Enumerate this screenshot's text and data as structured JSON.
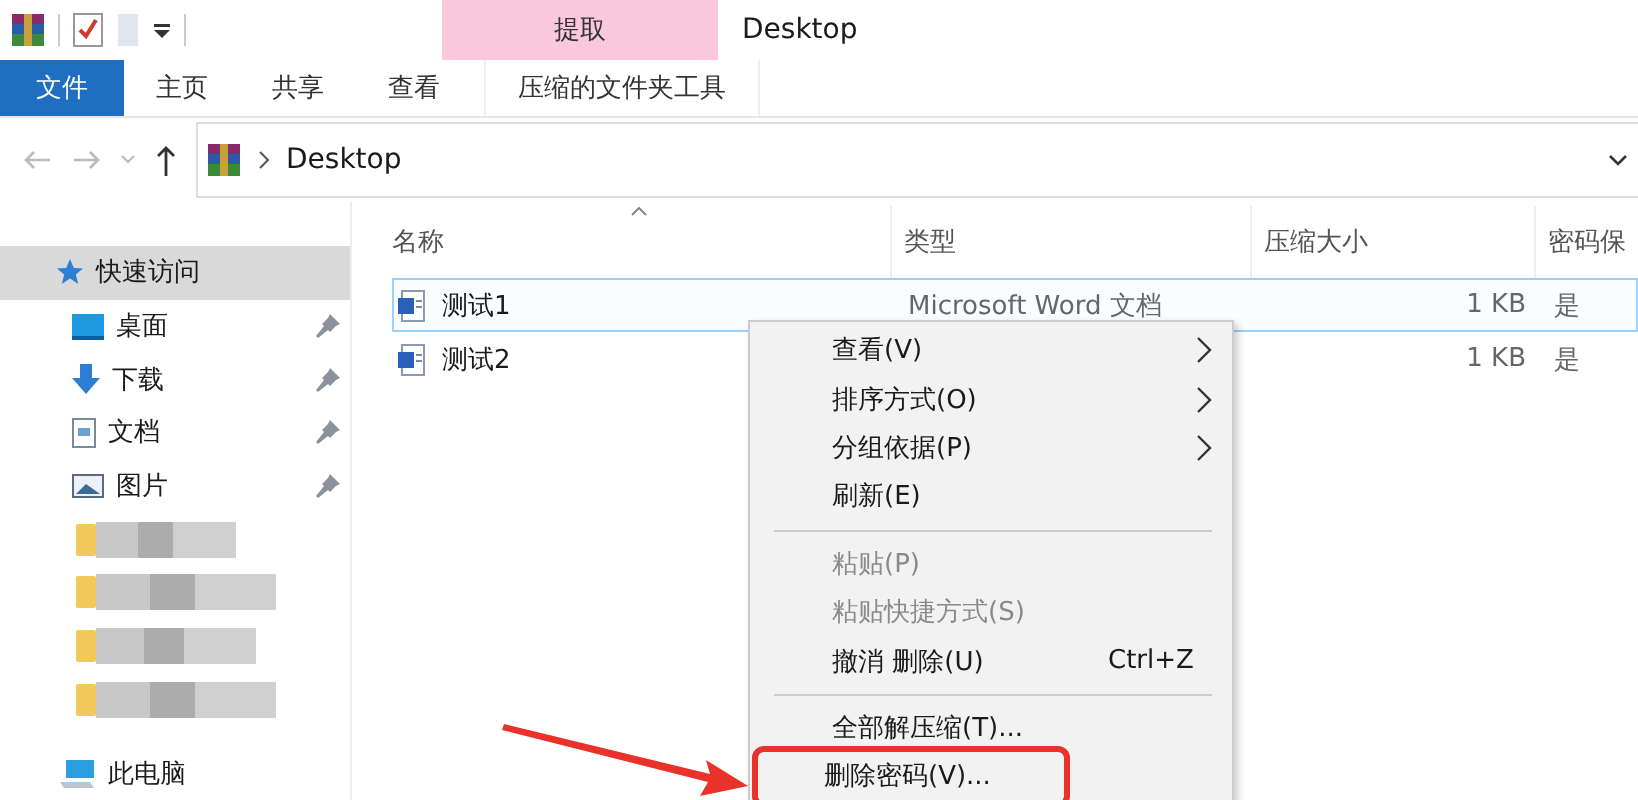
{
  "window": {
    "title": "Desktop"
  },
  "contextual_tab": {
    "label": "提取"
  },
  "ribbon_tabs": [
    {
      "label": "文件",
      "selected": true,
      "kind": "file"
    },
    {
      "label": "主页",
      "selected": false,
      "kind": "tab"
    },
    {
      "label": "共享",
      "selected": false,
      "kind": "tab"
    },
    {
      "label": "查看",
      "selected": false,
      "kind": "tab"
    },
    {
      "label": "压缩的文件夹工具",
      "selected": false,
      "kind": "contextual"
    }
  ],
  "address": {
    "path": "Desktop"
  },
  "sidebar": {
    "items": [
      {
        "label": "快速访问",
        "kind": "quick",
        "selected": true
      },
      {
        "label": "桌面",
        "kind": "desktop",
        "selected": false,
        "pinned": true
      },
      {
        "label": "下载",
        "kind": "download",
        "selected": false,
        "pinned": true
      },
      {
        "label": "文档",
        "kind": "documents",
        "selected": false,
        "pinned": true
      },
      {
        "label": "图片",
        "kind": "pictures",
        "selected": false,
        "pinned": true
      },
      {
        "kind": "redacted-folder",
        "selected": false
      },
      {
        "kind": "redacted-folder",
        "selected": false
      },
      {
        "kind": "redacted-folder",
        "selected": false
      },
      {
        "kind": "redacted-folder",
        "selected": false
      },
      {
        "label": "此电脑",
        "kind": "pc",
        "selected": false
      }
    ]
  },
  "table": {
    "columns": [
      "名称",
      "类型",
      "压缩大小",
      "密码保"
    ],
    "rows": [
      {
        "name": "测试1",
        "type": "Microsoft Word 文档",
        "size": "1 KB",
        "protected": "是",
        "selected": true
      },
      {
        "name": "测试2",
        "size": "1 KB",
        "protected": "是",
        "selected": false
      }
    ]
  },
  "context_menu": {
    "items": [
      {
        "kind": "item",
        "label": "查看(V)",
        "submenu": true,
        "disabled": false,
        "highlighted": false
      },
      {
        "kind": "item",
        "label": "排序方式(O)",
        "submenu": true,
        "disabled": false,
        "highlighted": false
      },
      {
        "kind": "item",
        "label": "分组依据(P)",
        "submenu": true,
        "disabled": false,
        "highlighted": false
      },
      {
        "kind": "item",
        "label": "刷新(E)",
        "disabled": false,
        "highlighted": false
      },
      {
        "kind": "separator"
      },
      {
        "kind": "item",
        "label": "粘贴(P)",
        "disabled": true,
        "highlighted": false
      },
      {
        "kind": "item",
        "label": "粘贴快捷方式(S)",
        "disabled": true,
        "highlighted": false
      },
      {
        "kind": "item",
        "label": "撤消 删除(U)",
        "shortcut": "Ctrl+Z",
        "disabled": false,
        "highlighted": false
      },
      {
        "kind": "separator"
      },
      {
        "kind": "item",
        "label": "全部解压缩(T)...",
        "disabled": false,
        "highlighted": false
      },
      {
        "kind": "item",
        "label": "删除密码(V)...",
        "disabled": false,
        "highlighted": true
      }
    ]
  }
}
